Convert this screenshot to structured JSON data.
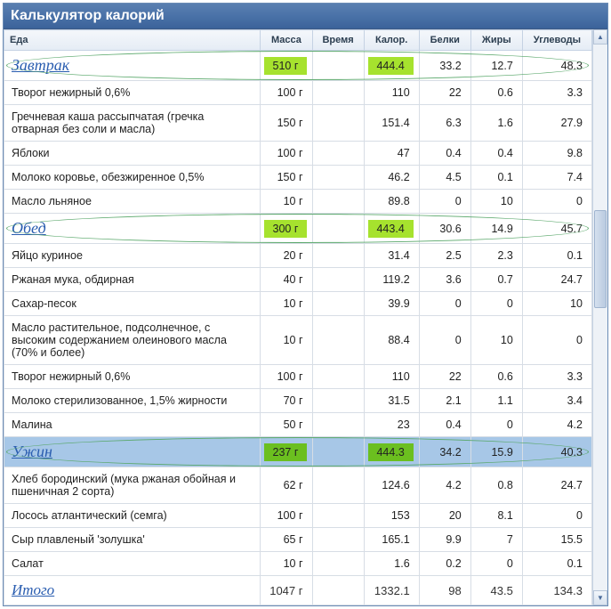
{
  "title": "Калькулятор калорий",
  "columns": {
    "food": "Еда",
    "mass": "Масса",
    "time": "Время",
    "cal": "Калор.",
    "prot": "Белки",
    "fat": "Жиры",
    "carb": "Углеводы"
  },
  "meals": [
    {
      "name": "Завтрак",
      "mass": "510 г",
      "cal": "444.4",
      "prot": "33.2",
      "fat": "12.7",
      "carb": "48.3",
      "selected": false,
      "items": [
        {
          "name": "Творог нежирный 0,6%",
          "mass": "100 г",
          "cal": "110",
          "prot": "22",
          "fat": "0.6",
          "carb": "3.3"
        },
        {
          "name": "Гречневая каша рассыпчатая (гречка отварная без соли и масла)",
          "mass": "150 г",
          "cal": "151.4",
          "prot": "6.3",
          "fat": "1.6",
          "carb": "27.9"
        },
        {
          "name": "Яблоки",
          "mass": "100 г",
          "cal": "47",
          "prot": "0.4",
          "fat": "0.4",
          "carb": "9.8"
        },
        {
          "name": "Молоко коровье, обезжиренное 0,5%",
          "mass": "150 г",
          "cal": "46.2",
          "prot": "4.5",
          "fat": "0.1",
          "carb": "7.4"
        },
        {
          "name": "Масло льняное",
          "mass": "10 г",
          "cal": "89.8",
          "prot": "0",
          "fat": "10",
          "carb": "0"
        }
      ]
    },
    {
      "name": "Обед",
      "mass": "300 г",
      "cal": "443.4",
      "prot": "30.6",
      "fat": "14.9",
      "carb": "45.7",
      "selected": false,
      "items": [
        {
          "name": "Яйцо куриное",
          "mass": "20 г",
          "cal": "31.4",
          "prot": "2.5",
          "fat": "2.3",
          "carb": "0.1"
        },
        {
          "name": "Ржаная мука, обдирная",
          "mass": "40 г",
          "cal": "119.2",
          "prot": "3.6",
          "fat": "0.7",
          "carb": "24.7"
        },
        {
          "name": "Сахар-песок",
          "mass": "10 г",
          "cal": "39.9",
          "prot": "0",
          "fat": "0",
          "carb": "10"
        },
        {
          "name": "Масло растительное, подсолнечное, с высоким содержанием олеинового масла (70% и более)",
          "mass": "10 г",
          "cal": "88.4",
          "prot": "0",
          "fat": "10",
          "carb": "0"
        },
        {
          "name": "Творог нежирный 0,6%",
          "mass": "100 г",
          "cal": "110",
          "prot": "22",
          "fat": "0.6",
          "carb": "3.3"
        },
        {
          "name": "Молоко стерилизованное, 1,5% жирности",
          "mass": "70 г",
          "cal": "31.5",
          "prot": "2.1",
          "fat": "1.1",
          "carb": "3.4"
        },
        {
          "name": "Малина",
          "mass": "50 г",
          "cal": "23",
          "prot": "0.4",
          "fat": "0",
          "carb": "4.2"
        }
      ]
    },
    {
      "name": "Ужин",
      "mass": "237 г",
      "cal": "444.3",
      "prot": "34.2",
      "fat": "15.9",
      "carb": "40.3",
      "selected": true,
      "items": [
        {
          "name": "Хлеб бородинский (мука ржаная обойная и пшеничная 2 сорта)",
          "mass": "62 г",
          "cal": "124.6",
          "prot": "4.2",
          "fat": "0.8",
          "carb": "24.7"
        },
        {
          "name": "Лосось атлантический (семга)",
          "mass": "100 г",
          "cal": "153",
          "prot": "20",
          "fat": "8.1",
          "carb": "0"
        },
        {
          "name": "Сыр плавленый 'золушка'",
          "mass": "65 г",
          "cal": "165.1",
          "prot": "9.9",
          "fat": "7",
          "carb": "15.5"
        },
        {
          "name": "Салат",
          "mass": "10 г",
          "cal": "1.6",
          "prot": "0.2",
          "fat": "0",
          "carb": "0.1"
        }
      ]
    }
  ],
  "total": {
    "label": "Итого",
    "mass": "1047 г",
    "cal": "1332.1",
    "prot": "98",
    "fat": "43.5",
    "carb": "134.3"
  }
}
